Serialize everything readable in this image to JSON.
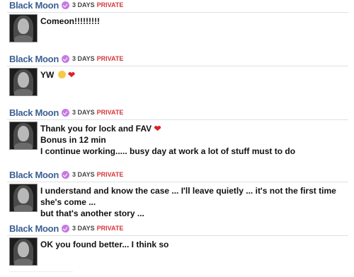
{
  "messages": [
    {
      "author": "Black Moon",
      "verified_icon": "verified-badge-icon",
      "age": "3 DAYS",
      "visibility": "PRIVATE",
      "lines": [
        "Comeon!!!!!!!!!"
      ]
    },
    {
      "author": "Black Moon",
      "verified_icon": "verified-badge-icon",
      "age": "3 DAYS",
      "visibility": "PRIVATE",
      "lines": [
        "YW"
      ],
      "emojis": [
        "blushing-face-emoji",
        "red-heart-emoji"
      ]
    },
    {
      "author": "Black Moon",
      "verified_icon": "verified-badge-icon",
      "age": "3 DAYS",
      "visibility": "PRIVATE",
      "lines": [
        "Thank you for lock and FAV",
        "Bonus in 12 min",
        "I continue working..... busy day at work a lot of stuff must to do"
      ],
      "emojis": [
        "red-heart-emoji"
      ]
    },
    {
      "author": "Black Moon",
      "verified_icon": "verified-badge-icon",
      "age": "3 DAYS",
      "visibility": "PRIVATE",
      "lines": [
        "I understand and know the case ... I'll leave quietly ... it's not the first time she's come ...",
        "but that's another story ..."
      ]
    },
    {
      "author": "Black Moon",
      "verified_icon": "verified-badge-icon",
      "age": "3 DAYS",
      "visibility": "PRIVATE",
      "lines": [
        "OK you found better... I think so"
      ]
    }
  ],
  "colors": {
    "author": "#3b5f94",
    "private": "#d6353b",
    "badge": "#c678e4",
    "heart": "#e0202a"
  }
}
